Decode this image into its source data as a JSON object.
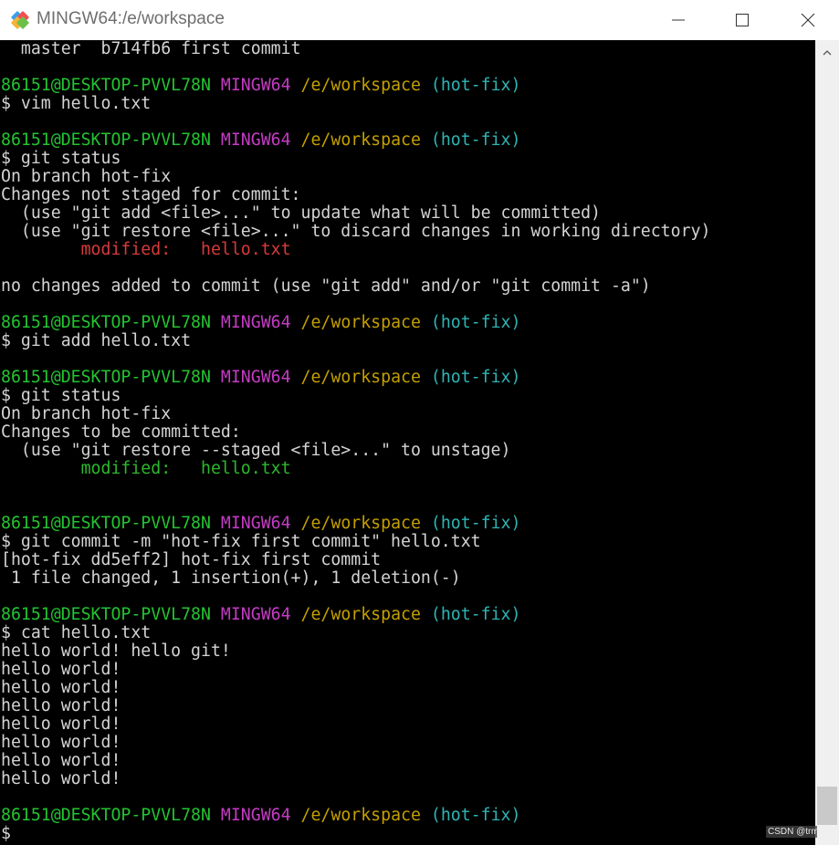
{
  "window": {
    "title": "MINGW64:/e/workspace",
    "app_icon": "git-bash-icon",
    "controls": {
      "minimize": "minimize-icon",
      "maximize": "maximize-icon",
      "close": "close-icon"
    }
  },
  "colors": {
    "prompt_user": "#23c431",
    "prompt_system": "#c43cc4",
    "prompt_path": "#c4a000",
    "prompt_branch": "#2fb4b4",
    "modified_unstaged": "#d73a3a",
    "modified_staged": "#2db82d",
    "text": "#d4d4d4",
    "background": "#000000"
  },
  "terminal": {
    "lines": [
      [
        {
          "t": "  master  b714fb6 first commit",
          "c": "default"
        }
      ],
      [],
      [
        {
          "t": "86151@DESKTOP-PVVL78N",
          "c": "user"
        },
        {
          "t": " ",
          "c": "default"
        },
        {
          "t": "MINGW64",
          "c": "sys"
        },
        {
          "t": " ",
          "c": "default"
        },
        {
          "t": "/e/workspace",
          "c": "path"
        },
        {
          "t": " ",
          "c": "default"
        },
        {
          "t": "(hot-fix)",
          "c": "branch"
        }
      ],
      [
        {
          "t": "$ vim hello.txt",
          "c": "default"
        }
      ],
      [],
      [
        {
          "t": "86151@DESKTOP-PVVL78N",
          "c": "user"
        },
        {
          "t": " ",
          "c": "default"
        },
        {
          "t": "MINGW64",
          "c": "sys"
        },
        {
          "t": " ",
          "c": "default"
        },
        {
          "t": "/e/workspace",
          "c": "path"
        },
        {
          "t": " ",
          "c": "default"
        },
        {
          "t": "(hot-fix)",
          "c": "branch"
        }
      ],
      [
        {
          "t": "$ git status",
          "c": "default"
        }
      ],
      [
        {
          "t": "On branch hot-fix",
          "c": "default"
        }
      ],
      [
        {
          "t": "Changes not staged for commit:",
          "c": "default"
        }
      ],
      [
        {
          "t": "  (use \"git add <file>...\" to update what will be committed)",
          "c": "default"
        }
      ],
      [
        {
          "t": "  (use \"git restore <file>...\" to discard changes in working directory)",
          "c": "default"
        }
      ],
      [
        {
          "t": "        modified:   hello.txt",
          "c": "red"
        }
      ],
      [],
      [
        {
          "t": "no changes added to commit (use \"git add\" and/or \"git commit -a\")",
          "c": "default"
        }
      ],
      [],
      [
        {
          "t": "86151@DESKTOP-PVVL78N",
          "c": "user"
        },
        {
          "t": " ",
          "c": "default"
        },
        {
          "t": "MINGW64",
          "c": "sys"
        },
        {
          "t": " ",
          "c": "default"
        },
        {
          "t": "/e/workspace",
          "c": "path"
        },
        {
          "t": " ",
          "c": "default"
        },
        {
          "t": "(hot-fix)",
          "c": "branch"
        }
      ],
      [
        {
          "t": "$ git add hello.txt",
          "c": "default"
        }
      ],
      [],
      [
        {
          "t": "86151@DESKTOP-PVVL78N",
          "c": "user"
        },
        {
          "t": " ",
          "c": "default"
        },
        {
          "t": "MINGW64",
          "c": "sys"
        },
        {
          "t": " ",
          "c": "default"
        },
        {
          "t": "/e/workspace",
          "c": "path"
        },
        {
          "t": " ",
          "c": "default"
        },
        {
          "t": "(hot-fix)",
          "c": "branch"
        }
      ],
      [
        {
          "t": "$ git status",
          "c": "default"
        }
      ],
      [
        {
          "t": "On branch hot-fix",
          "c": "default"
        }
      ],
      [
        {
          "t": "Changes to be committed:",
          "c": "default"
        }
      ],
      [
        {
          "t": "  (use \"git restore --staged <file>...\" to unstage)",
          "c": "default"
        }
      ],
      [
        {
          "t": "        modified:   hello.txt",
          "c": "green"
        }
      ],
      [],
      [],
      [
        {
          "t": "86151@DESKTOP-PVVL78N",
          "c": "user"
        },
        {
          "t": " ",
          "c": "default"
        },
        {
          "t": "MINGW64",
          "c": "sys"
        },
        {
          "t": " ",
          "c": "default"
        },
        {
          "t": "/e/workspace",
          "c": "path"
        },
        {
          "t": " ",
          "c": "default"
        },
        {
          "t": "(hot-fix)",
          "c": "branch"
        }
      ],
      [
        {
          "t": "$ git commit -m \"hot-fix first commit\" hello.txt",
          "c": "default"
        }
      ],
      [
        {
          "t": "[hot-fix dd5eff2] hot-fix first commit",
          "c": "default"
        }
      ],
      [
        {
          "t": " 1 file changed, 1 insertion(+), 1 deletion(-)",
          "c": "default"
        }
      ],
      [],
      [
        {
          "t": "86151@DESKTOP-PVVL78N",
          "c": "user"
        },
        {
          "t": " ",
          "c": "default"
        },
        {
          "t": "MINGW64",
          "c": "sys"
        },
        {
          "t": " ",
          "c": "default"
        },
        {
          "t": "/e/workspace",
          "c": "path"
        },
        {
          "t": " ",
          "c": "default"
        },
        {
          "t": "(hot-fix)",
          "c": "branch"
        }
      ],
      [
        {
          "t": "$ cat hello.txt",
          "c": "default"
        }
      ],
      [
        {
          "t": "hello world! hello git!",
          "c": "default"
        }
      ],
      [
        {
          "t": "hello world!",
          "c": "default"
        }
      ],
      [
        {
          "t": "hello world!",
          "c": "default"
        }
      ],
      [
        {
          "t": "hello world!",
          "c": "default"
        }
      ],
      [
        {
          "t": "hello world!",
          "c": "default"
        }
      ],
      [
        {
          "t": "hello world!",
          "c": "default"
        }
      ],
      [
        {
          "t": "hello world!",
          "c": "default"
        }
      ],
      [
        {
          "t": "hello world!",
          "c": "default"
        }
      ],
      [],
      [
        {
          "t": "86151@DESKTOP-PVVL78N",
          "c": "user"
        },
        {
          "t": " ",
          "c": "default"
        },
        {
          "t": "MINGW64",
          "c": "sys"
        },
        {
          "t": " ",
          "c": "default"
        },
        {
          "t": "/e/workspace",
          "c": "path"
        },
        {
          "t": " ",
          "c": "default"
        },
        {
          "t": "(hot-fix)",
          "c": "branch"
        }
      ],
      [
        {
          "t": "$",
          "c": "default"
        }
      ]
    ]
  },
  "scrollbar": {
    "up_arrow": "chevron-up-icon",
    "position_fraction": 0.97
  },
  "watermark": {
    "text": "CSDN @trmp"
  }
}
